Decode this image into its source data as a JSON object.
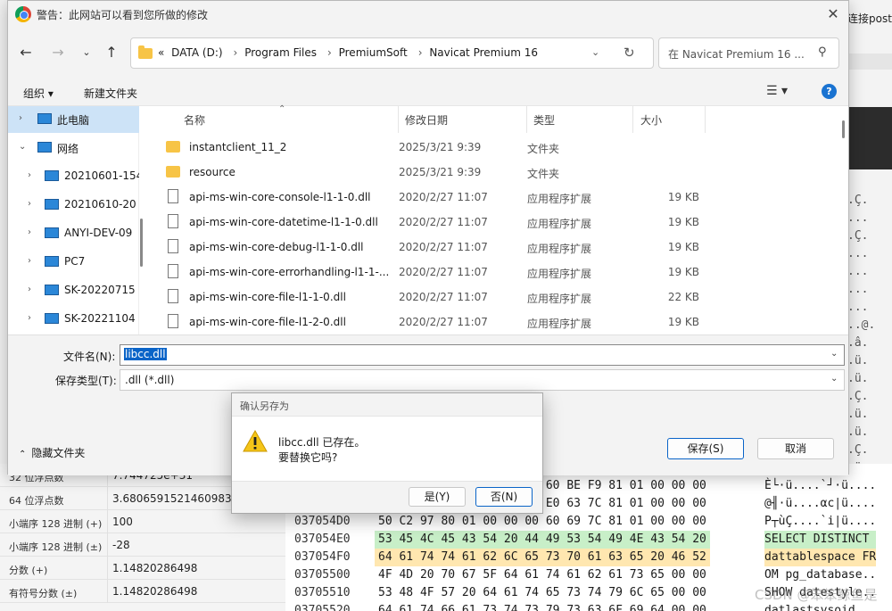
{
  "background": {
    "top_right_text": "连接postg",
    "inspector": [
      {
        "label": "32 位浮点数",
        "value": "7.744725e+31"
      },
      {
        "label": "64 位浮点数",
        "value": "3.6806591521460983e+"
      },
      {
        "label": "小端序 128 进制 (+)",
        "value": "100"
      },
      {
        "label": "小端序 128 进制 (±)",
        "value": "-28"
      },
      {
        "label": "分数 (+)",
        "value": "1.14820286498"
      },
      {
        "label": "有符号分数 (±)",
        "value": "1.14820286498"
      }
    ],
    "hex_rows": [
      {
        "addr": "",
        "bytes": "                     00 60 BE F9 81 01 00 00 00",
        "ascii": "È└·ü....`┘·ü...."
      },
      {
        "addr": "",
        "bytes": "                     00 E0 63 7C 81 01 00 00 00",
        "ascii": "@╢·ü....αc|ü...."
      },
      {
        "addr": "037054D0",
        "bytes": "50 C2 97 80 01 00 00 00 60 69 7C 81 01 00 00 00",
        "ascii": "P┬ùÇ....`i|ü...."
      },
      {
        "addr": "037054E0",
        "bytes": "53 45 4C 45 43 54 20 44 49 53 54 49 4E 43 54 20",
        "ascii": "SELECT DISTINCT "
      },
      {
        "addr": "037054F0",
        "bytes": "64 61 74 74 61 62 6C 65 73 70 61 63 65 20 46 52",
        "ascii": "dattablespace FR"
      },
      {
        "addr": "03705500",
        "bytes": "4F 4D 20 70 67 5F 64 61 74 61 62 61 73 65 00 00",
        "ascii": "OM pg_database.."
      },
      {
        "addr": "03705510",
        "bytes": "53 48 4F 57 20 64 61 74 65 73 74 79 6C 65 00 00",
        "ascii": "SHOW datestyle.."
      },
      {
        "addr": "03705520",
        "bytes": "64 61 74 66 61 73 74 73 79 73 63 6F 69 64 00 00",
        "ascii": "datlastsysoid.."
      }
    ],
    "side_ascii": ".Ç.\n...\n.Ç.\n...\n...\n...\n...\n..@.\n.â.\n.ü.\n.ü.\n.Ç.\n.ü.\n.ü.\n.Ç.\n.ü.\n.ü.",
    "watermark": "CSDN @笨笨鲸鱼是"
  },
  "dialog": {
    "title": "警告：此网站可以看到您所做的修改",
    "breadcrumbs": [
      "DATA (D:)",
      "Program Files",
      "PremiumSoft",
      "Navicat Premium 16"
    ],
    "breadcrumb_prefix": "«",
    "search_placeholder": "在 Navicat Premium 16 ...",
    "toolbar": {
      "organize": "组织 ▾",
      "new_folder": "新建文件夹",
      "view": "☰ ▾",
      "help": "?"
    },
    "nav_items": [
      {
        "label": "此电脑",
        "selected": true
      },
      {
        "label": "网络",
        "selected": false
      },
      {
        "label": "20210601-154",
        "selected": false
      },
      {
        "label": "20210610-20",
        "selected": false
      },
      {
        "label": "ANYI-DEV-09",
        "selected": false
      },
      {
        "label": "PC7",
        "selected": false
      },
      {
        "label": "SK-20220715",
        "selected": false
      },
      {
        "label": "SK-20221104",
        "selected": false
      }
    ],
    "columns": {
      "name": "名称",
      "date": "修改日期",
      "type": "类型",
      "size": "大小"
    },
    "files": [
      {
        "name": "instantclient_11_2",
        "date": "2025/3/21 9:39",
        "type": "文件夹",
        "size": "",
        "kind": "folder"
      },
      {
        "name": "resource",
        "date": "2025/3/21 9:39",
        "type": "文件夹",
        "size": "",
        "kind": "folder"
      },
      {
        "name": "api-ms-win-core-console-l1-1-0.dll",
        "date": "2020/2/27 11:07",
        "type": "应用程序扩展",
        "size": "19 KB",
        "kind": "dll"
      },
      {
        "name": "api-ms-win-core-datetime-l1-1-0.dll",
        "date": "2020/2/27 11:07",
        "type": "应用程序扩展",
        "size": "19 KB",
        "kind": "dll"
      },
      {
        "name": "api-ms-win-core-debug-l1-1-0.dll",
        "date": "2020/2/27 11:07",
        "type": "应用程序扩展",
        "size": "19 KB",
        "kind": "dll"
      },
      {
        "name": "api-ms-win-core-errorhandling-l1-1-...",
        "date": "2020/2/27 11:07",
        "type": "应用程序扩展",
        "size": "19 KB",
        "kind": "dll"
      },
      {
        "name": "api-ms-win-core-file-l1-1-0.dll",
        "date": "2020/2/27 11:07",
        "type": "应用程序扩展",
        "size": "22 KB",
        "kind": "dll"
      },
      {
        "name": "api-ms-win-core-file-l1-2-0.dll",
        "date": "2020/2/27 11:07",
        "type": "应用程序扩展",
        "size": "19 KB",
        "kind": "dll"
      }
    ],
    "filename_label": "文件名(N):",
    "filename_value": "libcc.dll",
    "filetype_label": "保存类型(T):",
    "filetype_value": ".dll (*.dll)",
    "hide_folders": "隐藏文件夹",
    "save_button": "保存(S)",
    "cancel_button": "取消"
  },
  "confirm": {
    "title": "确认另存为",
    "line1": "libcc.dll 已存在。",
    "line2": "要替换它吗?",
    "yes_button": "是(Y)",
    "no_button": "否(N)"
  },
  "colors": {
    "accent": "#0a64c8",
    "selection": "#cde3f7",
    "highlight_green": "#c8efc8",
    "highlight_orange": "#ffe7b0"
  }
}
